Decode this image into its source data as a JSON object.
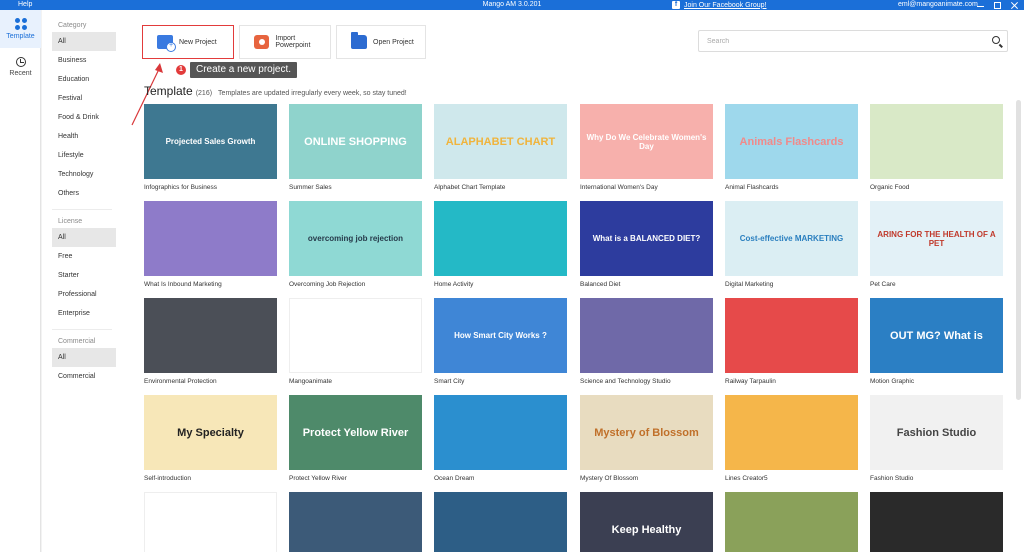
{
  "titlebar": {
    "menu_help": "Help",
    "app_title": "Mango AM 3.0.201",
    "facebook_link": "Join Our Facebook Group!",
    "email": "eml@mangoanimate.com"
  },
  "leftnav": {
    "items": [
      {
        "label": "Template",
        "icon": "template-grid-icon",
        "active": true
      },
      {
        "label": "Recent",
        "icon": "clock-icon",
        "active": false
      }
    ]
  },
  "filters": {
    "category": {
      "heading": "Category",
      "items": [
        "All",
        "Business",
        "Education",
        "Festival",
        "Food & Drink",
        "Health",
        "Lifestyle",
        "Technology",
        "Others"
      ],
      "selected": "All"
    },
    "license": {
      "heading": "License",
      "items": [
        "All",
        "Free",
        "Starter",
        "Professional",
        "Enterprise"
      ],
      "selected": "All"
    },
    "commercial": {
      "heading": "Commercial",
      "items": [
        "All",
        "Commercial"
      ],
      "selected": "All"
    }
  },
  "toolbar": {
    "new_project": "New Project",
    "import_powerpoint": "Import Powerpoint",
    "open_project": "Open Project"
  },
  "search": {
    "placeholder": "Search"
  },
  "tooltip": {
    "badge": "1",
    "text": "Create a new project."
  },
  "templates_header": {
    "title": "Template",
    "count": "(216)",
    "note": "Templates are updated irregularly every week, so stay tuned!"
  },
  "templates": [
    {
      "name": "Infographics for Business",
      "bg": "#3e7891",
      "thumb_text": "Projected Sales Growth",
      "fg": "#ffffff"
    },
    {
      "name": "Summer Sales",
      "bg": "#8fd3cc",
      "thumb_text": "ONLINE SHOPPING",
      "fg": "#ffffff"
    },
    {
      "name": "Alphabet Chart Template",
      "bg": "#cfe8ec",
      "thumb_text": "ALAPHABET CHART",
      "fg": "#f0b43c"
    },
    {
      "name": "International Women's Day",
      "bg": "#f7b0ac",
      "thumb_text": "Why Do We Celebrate Women's Day",
      "fg": "#ffffff"
    },
    {
      "name": "Animal Flashcards",
      "bg": "#9ed8ec",
      "thumb_text": "Animals Flashcards",
      "fg": "#f08a8a"
    },
    {
      "name": "Organic Food",
      "bg": "#d9e9c7",
      "thumb_text": "",
      "fg": "#333333"
    },
    {
      "name": "What Is Inbound Marketing",
      "bg": "#8e7bc9",
      "thumb_text": "",
      "fg": "#ffffff"
    },
    {
      "name": "Overcoming Job Rejection",
      "bg": "#8fd9d4",
      "thumb_text": "overcoming job rejection",
      "fg": "#263a4a"
    },
    {
      "name": "Home Activity",
      "bg": "#24b9c6",
      "thumb_text": "",
      "fg": "#ffffff"
    },
    {
      "name": "Balanced Diet",
      "bg": "#2d3c9e",
      "thumb_text": "What is a BALANCED DIET?",
      "fg": "#ffffff"
    },
    {
      "name": "Digital Marketing",
      "bg": "#dbeef3",
      "thumb_text": "Cost-effective MARKETING",
      "fg": "#2a7fbf"
    },
    {
      "name": "Pet Care",
      "bg": "#e3f1f7",
      "thumb_text": "ARING FOR THE HEALTH OF A PET",
      "fg": "#c0392b"
    },
    {
      "name": "Environmental Protection",
      "bg": "#4b4f57",
      "thumb_text": "",
      "fg": "#ffffff"
    },
    {
      "name": "Mangoanimate",
      "bg": "#ffffff",
      "thumb_text": "",
      "fg": "#333333"
    },
    {
      "name": "Smart City",
      "bg": "#3f86d6",
      "thumb_text": "How Smart City Works ?",
      "fg": "#ffffff"
    },
    {
      "name": "Science and Technology Studio",
      "bg": "#6f69a8",
      "thumb_text": "",
      "fg": "#ffffff"
    },
    {
      "name": "Railway Tarpaulin",
      "bg": "#e64a4a",
      "thumb_text": "",
      "fg": "#ffffff"
    },
    {
      "name": "Motion Graphic",
      "bg": "#2b7fc4",
      "thumb_text": "OUT MG? What is",
      "fg": "#ffffff"
    },
    {
      "name": "Self-introduction",
      "bg": "#f7e7b8",
      "thumb_text": "My Specialty",
      "fg": "#222222"
    },
    {
      "name": "Protect Yellow River",
      "bg": "#4e8a6a",
      "thumb_text": "Protect Yellow River",
      "fg": "#ffffff"
    },
    {
      "name": "Ocean Dream",
      "bg": "#2b8fcf",
      "thumb_text": "",
      "fg": "#ffffff"
    },
    {
      "name": "Mystery Of Blossom",
      "bg": "#e8dcc0",
      "thumb_text": "Mystery of Blossom",
      "fg": "#c0702a"
    },
    {
      "name": "Lines Creator5",
      "bg": "#f5b64a",
      "thumb_text": "",
      "fg": "#ffffff"
    },
    {
      "name": "Fashion Studio",
      "bg": "#f1f1f1",
      "thumb_text": "Fashion Studio",
      "fg": "#444444"
    },
    {
      "name": "",
      "bg": "#ffffff",
      "thumb_text": "",
      "fg": "#333333"
    },
    {
      "name": "",
      "bg": "#3c5a78",
      "thumb_text": "",
      "fg": "#ffffff"
    },
    {
      "name": "",
      "bg": "#2d5e86",
      "thumb_text": "",
      "fg": "#ffffff"
    },
    {
      "name": "",
      "bg": "#3b3f52",
      "thumb_text": "Keep Healthy",
      "fg": "#ffffff"
    },
    {
      "name": "",
      "bg": "#8aa15a",
      "thumb_text": "",
      "fg": "#ffffff"
    },
    {
      "name": "",
      "bg": "#2a2a2a",
      "thumb_text": "",
      "fg": "#ffffff"
    }
  ]
}
